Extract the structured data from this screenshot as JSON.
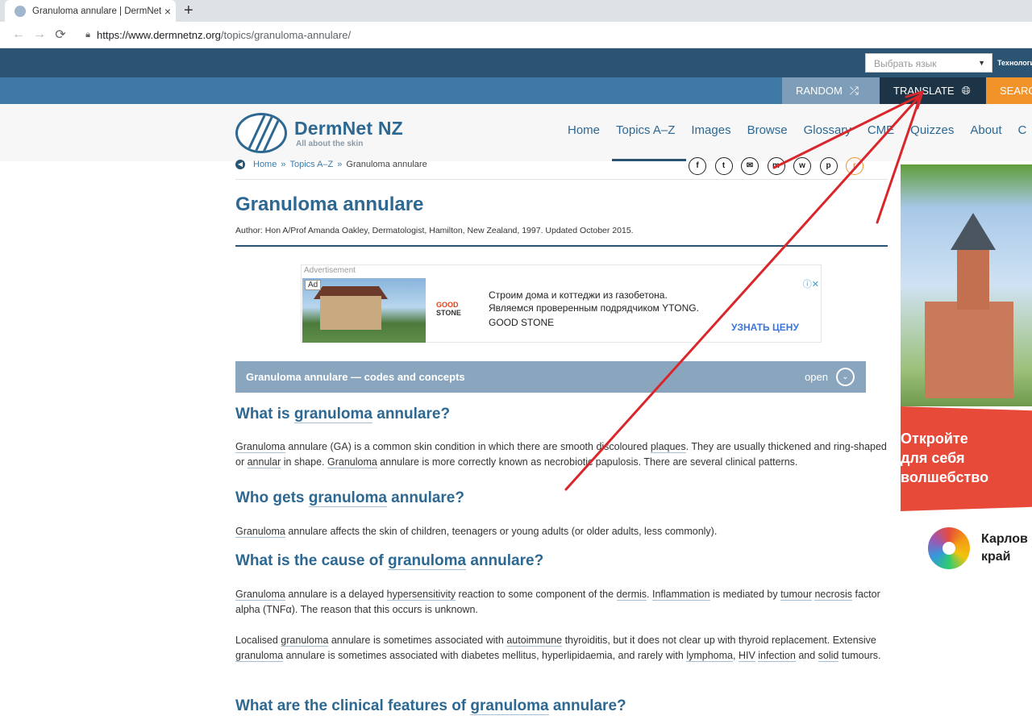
{
  "browser": {
    "tab_title": "Granuloma annulare | DermNet N",
    "tab_close": "×",
    "new_tab": "+",
    "back": "←",
    "forward": "→",
    "reload": "⟳",
    "url_host": "https://www.dermnetnz.org",
    "url_path": "/topics/granuloma-annulare/"
  },
  "topbar": {
    "language_select": "Выбрать язык",
    "language_credit": "Технологи"
  },
  "subbar": {
    "random": "RANDOM",
    "translate": "TRANSLATE",
    "search": "SEARC"
  },
  "header": {
    "logo_name": "DermNet NZ",
    "logo_tagline": "All about the skin",
    "nav": [
      "Home",
      "Topics A–Z",
      "Images",
      "Browse",
      "Glossary",
      "CME",
      "Quizzes",
      "About",
      "C"
    ]
  },
  "breadcrumb": {
    "home": "Home",
    "sep": "»",
    "topics": "Topics A–Z",
    "current": "Granuloma annulare"
  },
  "share_icons": [
    "f",
    "t",
    "✉",
    "m",
    "w",
    "p",
    "r"
  ],
  "article": {
    "title": "Granuloma annulare",
    "author": "Author: Hon A/Prof Amanda Oakley, Dermatologist, Hamilton, New Zealand, 1997. Updated October 2015.",
    "codes_title": "Granuloma annulare — codes and concepts",
    "codes_open": "open",
    "codes_chevron": "⌄",
    "h_what": [
      "What is ",
      "granuloma",
      " annulare?"
    ],
    "p_what": [
      "Granuloma",
      " annulare (GA) is a common skin condition in which there are smooth discoloured ",
      "plaques",
      ". They are usually thickened and ring-shaped or ",
      "annular",
      " in shape. ",
      "Granuloma",
      " annulare is more correctly known as necrobiotic papulosis. There are several clinical patterns."
    ],
    "h_who": [
      "Who gets ",
      "granuloma",
      " annulare?"
    ],
    "p_who": [
      "Granuloma",
      " annulare affects the skin of children, teenagers or young adults (or older adults, less commonly)."
    ],
    "h_cause": [
      "What is the cause of ",
      "granuloma",
      " annulare?"
    ],
    "p_cause1": [
      "Granuloma",
      " annulare is a delayed ",
      "hypersensitivity",
      " reaction to some component of the ",
      "dermis",
      ". ",
      "Inflammation",
      " is mediated by ",
      "tumour",
      " ",
      "necrosis",
      " factor alpha (TNFα). The reason that this occurs is unknown."
    ],
    "p_cause2": [
      "Localised ",
      "granuloma",
      " annulare is sometimes associated with ",
      "autoimmune",
      " thyroiditis, but it does not clear up with thyroid replacement. Extensive ",
      "granuloma",
      " annulare is sometimes associated with diabetes mellitus, hyperlipidaemia, and rarely with ",
      "lymphoma",
      ", ",
      "HIV",
      " ",
      "infection",
      " and ",
      "solid",
      " tumours."
    ],
    "h_clin": [
      "What are the clinical features of ",
      "granuloma",
      " annulare?"
    ]
  },
  "ad": {
    "label": "Advertisement",
    "badge": "Ad",
    "brand_top": "GOOD",
    "brand_bottom": "STONE",
    "line1": "Строим дома и коттеджи из газобетона.",
    "line2": "Являемся проверенным подрядчиком YTONG.",
    "line3": "GOOD STONE",
    "cta": "УЗНАТЬ ЦЕНУ",
    "close": "ⓘ✕"
  },
  "side_ad": {
    "line1": "Откройте",
    "line2": "для себя",
    "line3": "волшебство",
    "brand_line1": "Карлов",
    "brand_line2": "край"
  },
  "colors": {
    "brand_blue": "#2d6892",
    "topbar": "#2b5472",
    "subbar": "#3f7aa7",
    "search_orange": "#f2932a",
    "annotation_red": "#d9262b"
  },
  "icons": {
    "random": "shuffle-icon",
    "translate": "globe-icon",
    "lock": "lock-icon"
  }
}
